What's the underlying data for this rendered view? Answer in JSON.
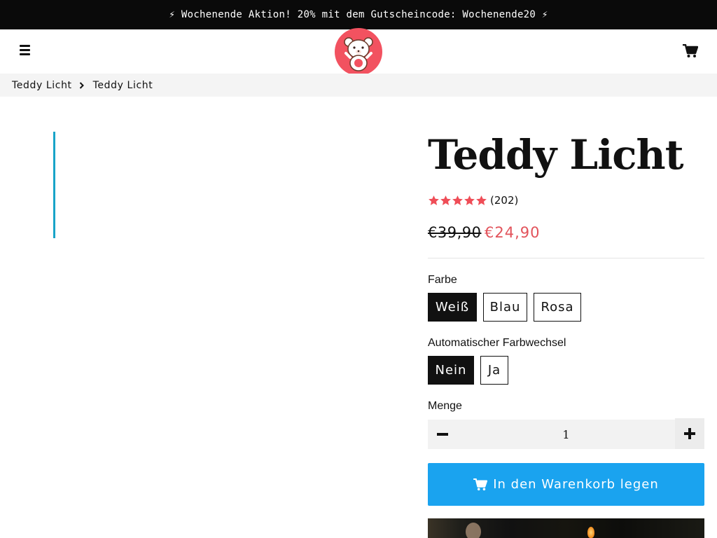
{
  "announcement": {
    "text": "⚡ Wochenende Aktion! 20% mit dem Gutscheincode: Wochenende20 ⚡"
  },
  "header": {
    "menu_icon": "hamburger-menu-icon",
    "logo_icon": "teddy-bear-logo-icon",
    "cart_icon": "shopping-cart-icon"
  },
  "breadcrumb": {
    "items": [
      {
        "label": "Teddy Licht"
      },
      {
        "label": "Teddy Licht"
      }
    ],
    "separator_icon": "chevron-right-icon"
  },
  "product": {
    "title": "Teddy Licht",
    "rating": {
      "stars": 5,
      "max": 5,
      "count_text": "(202)"
    },
    "price_old": "€39,90",
    "price_new": "€24,90",
    "options": [
      {
        "label": "Farbe",
        "values": [
          "Weiß",
          "Blau",
          "Rosa"
        ],
        "selected": "Weiß"
      },
      {
        "label": "Automatischer Farbwechsel",
        "values": [
          "Nein",
          "Ja"
        ],
        "selected": "Nein"
      }
    ],
    "quantity": {
      "label": "Menge",
      "value": "1"
    },
    "add_to_cart": "In den Warenkorb legen"
  },
  "colors": {
    "announcement_bg": "#0a0a0a",
    "accent_blue": "#1aa3ef",
    "sale_red": "#e2535b",
    "star_red": "#ef4d57",
    "logo_bg": "#f25260",
    "thumb_bar": "#18a4c8"
  }
}
